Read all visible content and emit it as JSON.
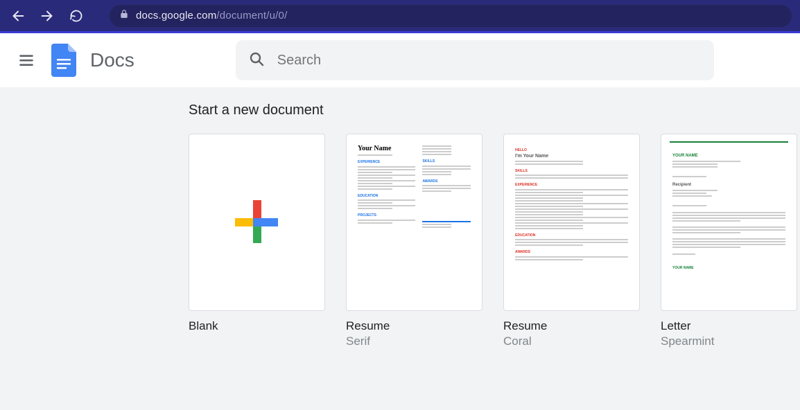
{
  "browser": {
    "url_host": "docs.google.com",
    "url_path": "/document/u/0/"
  },
  "header": {
    "app_name": "Docs",
    "search_placeholder": "Search"
  },
  "templates": {
    "section_title": "Start a new document",
    "items": [
      {
        "name": "Blank",
        "subtitle": ""
      },
      {
        "name": "Resume",
        "subtitle": "Serif"
      },
      {
        "name": "Resume",
        "subtitle": "Coral"
      },
      {
        "name": "Letter",
        "subtitle": "Spearmint"
      }
    ]
  }
}
